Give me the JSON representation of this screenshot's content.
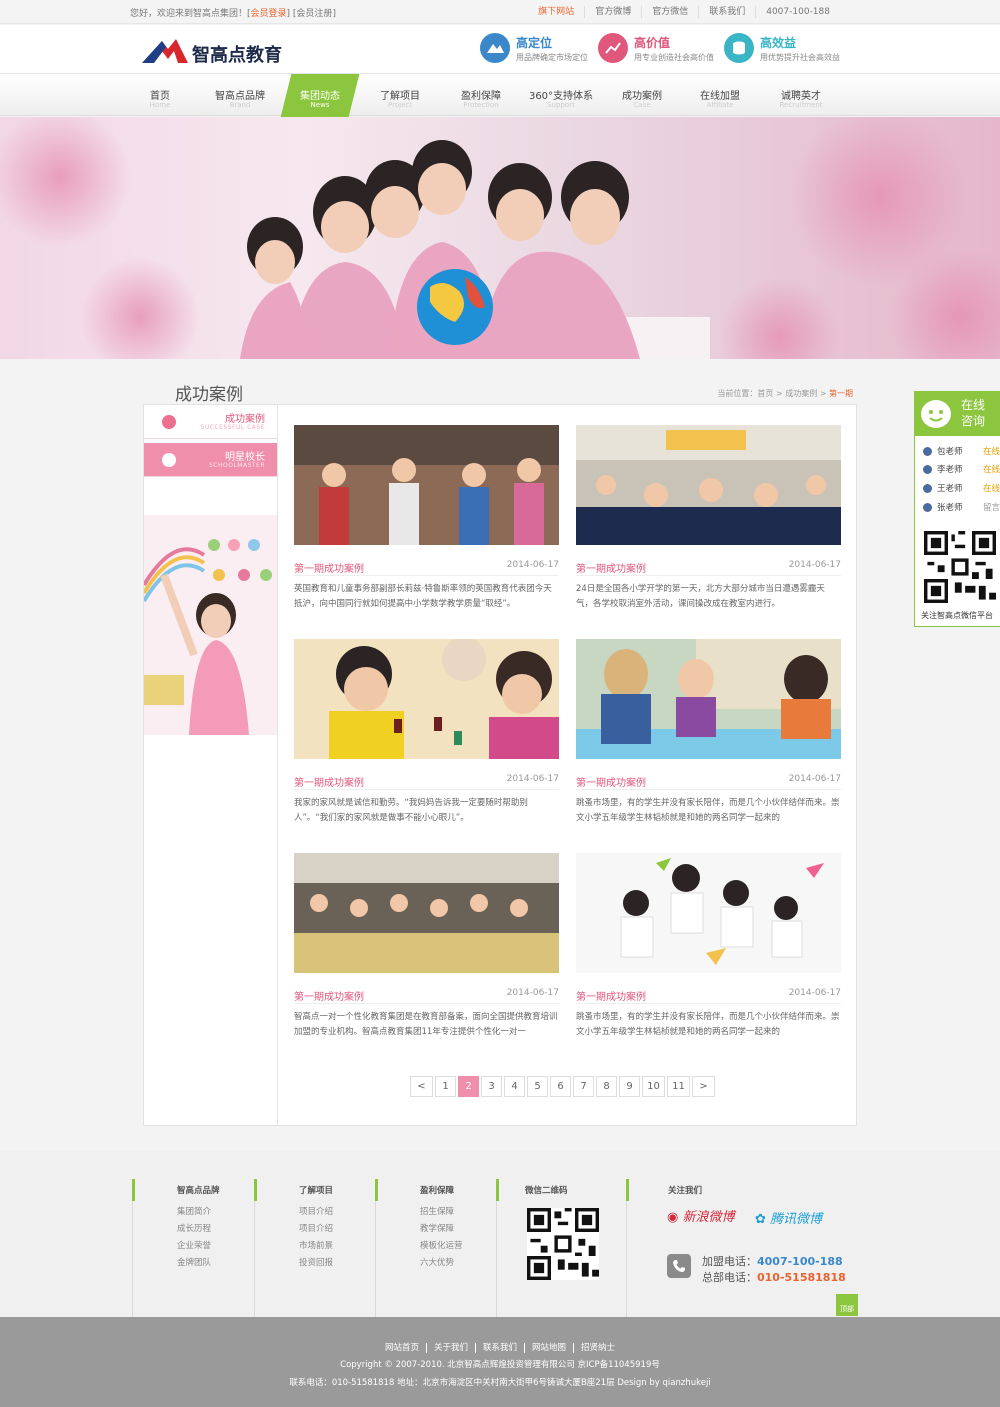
{
  "topbar": {
    "welcome_prefix": "您好，欢迎来到智高点集团！[",
    "login": "会员登录",
    "sep": "] [",
    "register": "会员注册",
    "suffix": "]",
    "links": [
      "旗下网站",
      "官方微博",
      "官方微信",
      "联系我们",
      "4007-100-188"
    ]
  },
  "header": {
    "logo_text": "智高点教育",
    "features": [
      {
        "title": "高定位",
        "sub": "用品牌确定市场定位",
        "color": "#3a87c9"
      },
      {
        "title": "高价值",
        "sub": "用专业创造社会高价值",
        "color": "#e0577c"
      },
      {
        "title": "高效益",
        "sub": "用优势提升社会高效益",
        "color": "#3ab5c6"
      }
    ]
  },
  "nav": [
    {
      "cn": "首页",
      "en": "Home"
    },
    {
      "cn": "智高点品牌",
      "en": "Brand"
    },
    {
      "cn": "集团动态",
      "en": "News"
    },
    {
      "cn": "了解项目",
      "en": "Project"
    },
    {
      "cn": "盈利保障",
      "en": "Protection"
    },
    {
      "cn": "360°支持体系",
      "en": "Support"
    },
    {
      "cn": "成功案例",
      "en": "Case"
    },
    {
      "cn": "在线加盟",
      "en": "Affiliate"
    },
    {
      "cn": "诚聘英才",
      "en": "Recruitment"
    }
  ],
  "page": {
    "title": "成功案例",
    "crumb_prefix": "当前位置：首页 > 成功案例 > ",
    "crumb_current": "第一期"
  },
  "sidebar": [
    {
      "cn": "成功案例",
      "en": "SUCCESSFUL CASE"
    },
    {
      "cn": "明星校长",
      "en": "SCHOOLMASTER"
    }
  ],
  "cards": [
    {
      "title": "第一期成功案例",
      "date": "2014-06-17",
      "desc": "英国教育和儿童事务部副部长莉兹·特鲁斯率领的英国教育代表团今天抵沪，向中国同行就如何提高中小学数学教学质量“取经”。"
    },
    {
      "title": "第一期成功案例",
      "date": "2014-06-17",
      "desc": "24日是全国各小学开学的第一天，北方大部分城市当日遭遇雾霾天气，各学校取消室外活动，课间操改成在教室内进行。"
    },
    {
      "title": "第一期成功案例",
      "date": "2014-06-17",
      "desc": "我家的家风就是诚信和勤劳。“我妈妈告诉我一定要随时帮助别人”。“我们家的家风就是做事不能小心眼儿”。"
    },
    {
      "title": "第一期成功案例",
      "date": "2014-06-17",
      "desc": "跳蚤市场里，有的学生并没有家长陪伴，而是几个小伙伴结伴而来。崇文小学五年级学生林韬桢就是和她的两名同学一起来的"
    },
    {
      "title": "第一期成功案例",
      "date": "2014-06-17",
      "desc": "智高点一对一个性化教育集团是在教育部备案，面向全国提供教育培训加盟的专业机构。智高点教育集团11年专注提供个性化一对一"
    },
    {
      "title": "第一期成功案例",
      "date": "2014-06-17",
      "desc": "跳蚤市场里，有的学生并没有家长陪伴，而是几个小伙伴结伴而来。崇文小学五年级学生林韬桢就是和她的两名同学一起来的"
    }
  ],
  "pager": {
    "prev": "<",
    "next": ">",
    "pages": [
      "1",
      "2",
      "3",
      "4",
      "5",
      "6",
      "7",
      "8",
      "9",
      "10",
      "11"
    ],
    "current": "2"
  },
  "float": {
    "title1": "在线",
    "title2": "咨询",
    "teachers": [
      {
        "name": "包老师",
        "status": "在线"
      },
      {
        "name": "李老师",
        "status": "在线"
      },
      {
        "name": "王老师",
        "status": "在线"
      },
      {
        "name": "张老师",
        "status": "留言"
      }
    ],
    "qr_caption": "关注智高点微信平台"
  },
  "footer": {
    "cols": [
      {
        "head": "智高点品牌",
        "links": [
          "集团简介",
          "成长历程",
          "企业荣誉",
          "金牌团队"
        ]
      },
      {
        "head": "了解项目",
        "links": [
          "项目介绍",
          "项目介绍",
          "市场前景",
          "投资回报"
        ]
      },
      {
        "head": "盈利保障",
        "links": [
          "招生保障",
          "教学保障",
          "模板化运营",
          "六大优势"
        ]
      },
      {
        "head": "微信二维码",
        "links": []
      },
      {
        "head": "关注我们",
        "links": []
      }
    ],
    "weibo": "新浪微博",
    "tweibo": "腾讯微博",
    "hotline_label": "加盟电话：",
    "hotline": "4007-100-188",
    "hq_label": "总部电话：",
    "hq": "010-51581818",
    "top": "顶部"
  },
  "copyright": {
    "links": [
      "网站首页",
      "关于我们",
      "联系我们",
      "网站地图",
      "招贤纳士"
    ],
    "line2": "Copyright © 2007-2010. 北京智高点辉煌投资管理有限公司 京ICP备11045919号",
    "line3": "联系电话：010-51581818    地址：北京市海淀区中关村南大街甲6号铸诚大厦B座21层  Design by qianzhukeji"
  }
}
